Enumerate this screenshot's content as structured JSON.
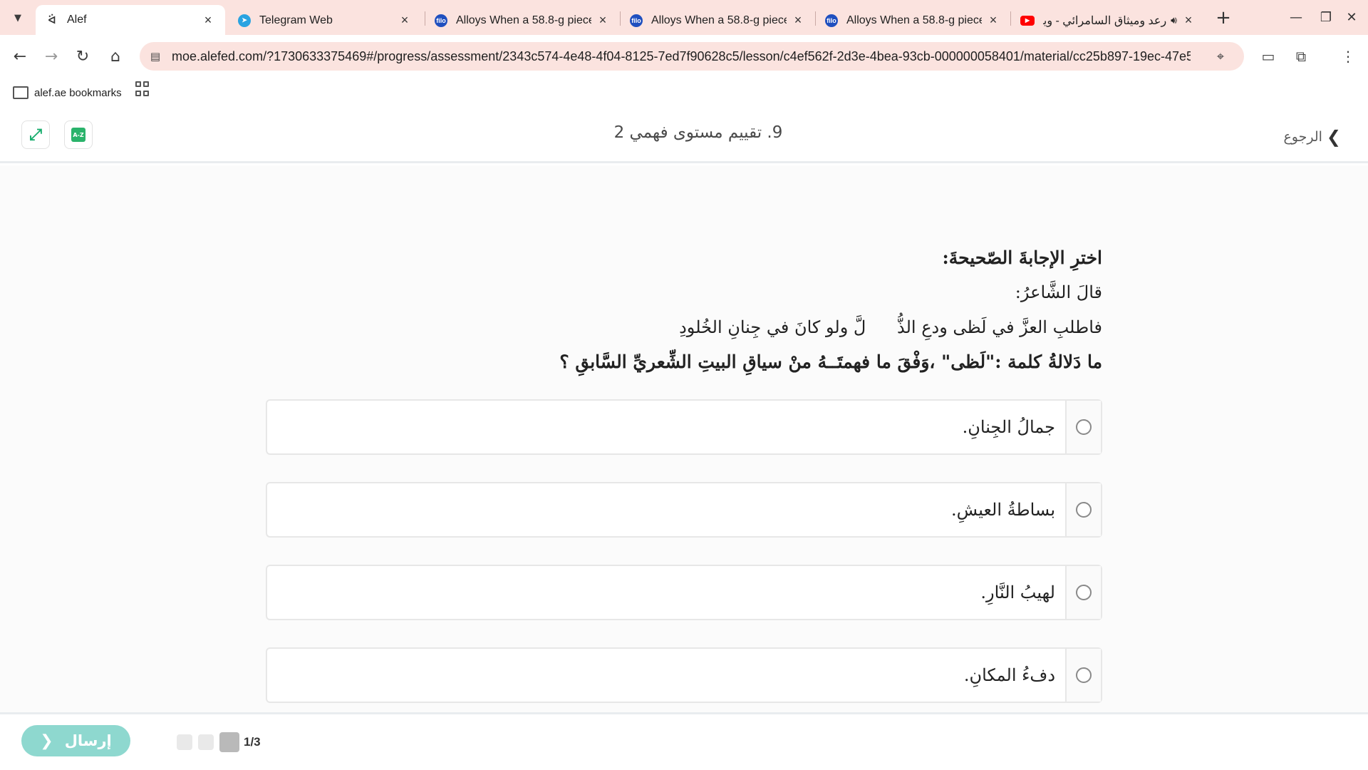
{
  "browser": {
    "tabs": [
      {
        "title": "Alef",
        "icon": "alef-icon",
        "active": true
      },
      {
        "title": "Telegram Web",
        "icon": "telegram-icon",
        "active": false
      },
      {
        "title": "Alloys When a 58.8-g piece",
        "icon": "filo-icon",
        "active": false
      },
      {
        "title": "Alloys When a 58.8-g piece",
        "icon": "filo-icon",
        "active": false
      },
      {
        "title": "Alloys When a 58.8-g piece",
        "icon": "filo-icon",
        "active": false
      },
      {
        "title": "رعد وميثاق السامرائي - وين",
        "icon": "youtube-icon",
        "active": false
      }
    ],
    "url": "moe.alefed.com/?1730633375469#/progress/assessment/2343c574-4e48-4f04-8125-7ed7f90628c5/lesson/c4ef562f-2d3e-4bea-93cb-000000058401/material/cc25b897-19ec-47e5-...",
    "bookmarks": {
      "folder_label": "alef.ae bookmarks"
    },
    "colors": {
      "tabstrip": "#fbe3df",
      "omnibox": "#fbe3df"
    }
  },
  "header": {
    "title": "9. تقييم مستوى فهمي 2",
    "back_label": "الرجوع",
    "az_label": "A-Z"
  },
  "question": {
    "instruction": "اخترِ الإجابةَ الصّحيحةَ:",
    "poet_intro": "قالَ الشَّاعرُ:",
    "verse_first": "فاطلبِ العزَّ في لَظى ودعِ الذُّ",
    "verse_second": "لَّ ولو كانَ في جِنانِ الخُلودِ",
    "main": "ما دَلالةُ كلمة :\"لَظى\" ،وَفْقَ ما فهمتَــهُ منْ سياقِ البيتِ الشِّعريِّ السَّابقِ ؟"
  },
  "options": [
    {
      "label": "جمالُ الجِنانِ."
    },
    {
      "label": "بساطةُ العيشِ."
    },
    {
      "label": "لهيبُ النَّارِ."
    },
    {
      "label": "دفءُ المكانِ."
    }
  ],
  "footer": {
    "submit_label": "إرسال",
    "progress_label": "1/3",
    "progress": {
      "current": 1,
      "total": 3
    }
  },
  "theme": {
    "accent": "#8ed8cf",
    "brand_green": "#2ab36b"
  }
}
